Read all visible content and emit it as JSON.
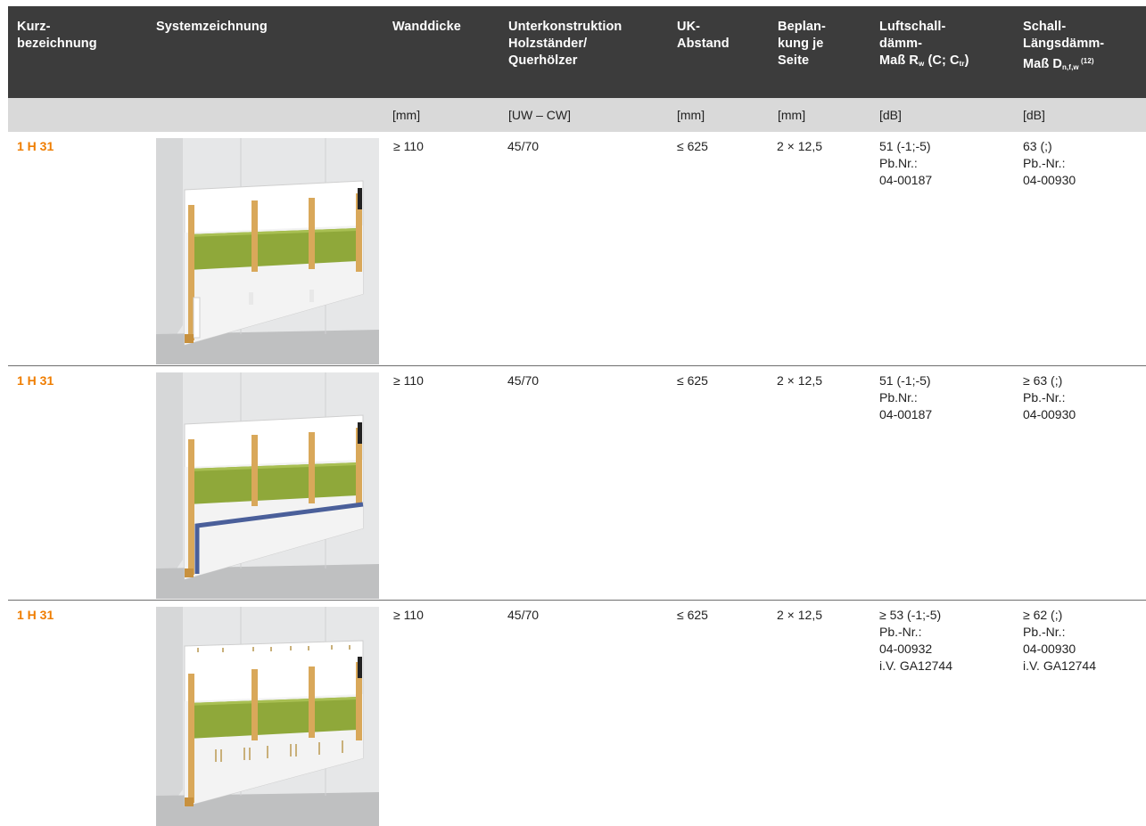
{
  "header": {
    "col1": [
      "Kurz-",
      "bezeichnung"
    ],
    "col2": [
      "Systemzeichnung"
    ],
    "col3": [
      "Wanddicke"
    ],
    "col4": [
      "Unterkonstruktion",
      "Holzständer/",
      "Querhölzer"
    ],
    "col5": [
      "UK-",
      "Abstand"
    ],
    "col6": [
      "Beplan-",
      "kung je",
      "Seite"
    ],
    "col7": {
      "l1": "Luftschall-",
      "l2": "dämm-",
      "l3_pre": "Maß R",
      "l3_sub": "w",
      "l3_mid": " (C; C",
      "l3_sub2": "tr",
      "l3_post": ")"
    },
    "col8": {
      "l1": "Schall-",
      "l2": "Längsdämm-",
      "l3_pre": "Maß D",
      "l3_sub": "n,f,w",
      "l3_sup": " (12)"
    }
  },
  "units": [
    "[mm]",
    "[UW – CW]",
    "[mm]",
    "[mm]",
    "[dB]",
    "[dB]"
  ],
  "rows": [
    {
      "code": "1 H 31",
      "wanddicke": "≥ 110",
      "uk": "45/70",
      "abstand": "≤ 625",
      "beplankung": "2 × 12,5",
      "luft": [
        "51 (-1;-5)",
        "Pb.Nr.:",
        "04-00187"
      ],
      "laengs": [
        "63 (;)",
        "Pb.-Nr.:",
        "04-00930"
      ]
    },
    {
      "code": "1 H 31",
      "wanddicke": "≥ 110",
      "uk": "45/70",
      "abstand": "≤ 625",
      "beplankung": "2 × 12,5",
      "luft": [
        "51 (-1;-5)",
        "Pb.Nr.:",
        "04-00187"
      ],
      "laengs": [
        "≥ 63 (;)",
        "Pb.-Nr.:",
        "04-00930"
      ]
    },
    {
      "code": "1 H 31",
      "wanddicke": "≥ 110",
      "uk": "45/70",
      "abstand": "≤ 625",
      "beplankung": "2 × 12,5",
      "luft": [
        "≥ 53 (-1;-5)",
        "Pb.-Nr.:",
        "04-00932",
        "i.V. GA12744"
      ],
      "laengs": [
        "≥ 62 (;)",
        "Pb.-Nr.:",
        "04-00930",
        "i.V. GA12744"
      ]
    }
  ],
  "colors": {
    "header": "#3c3c3c",
    "units_band": "#d9d9d9",
    "code": "#ef7d00",
    "insulation": "#8fa83a",
    "stud": "#d9a85a"
  }
}
